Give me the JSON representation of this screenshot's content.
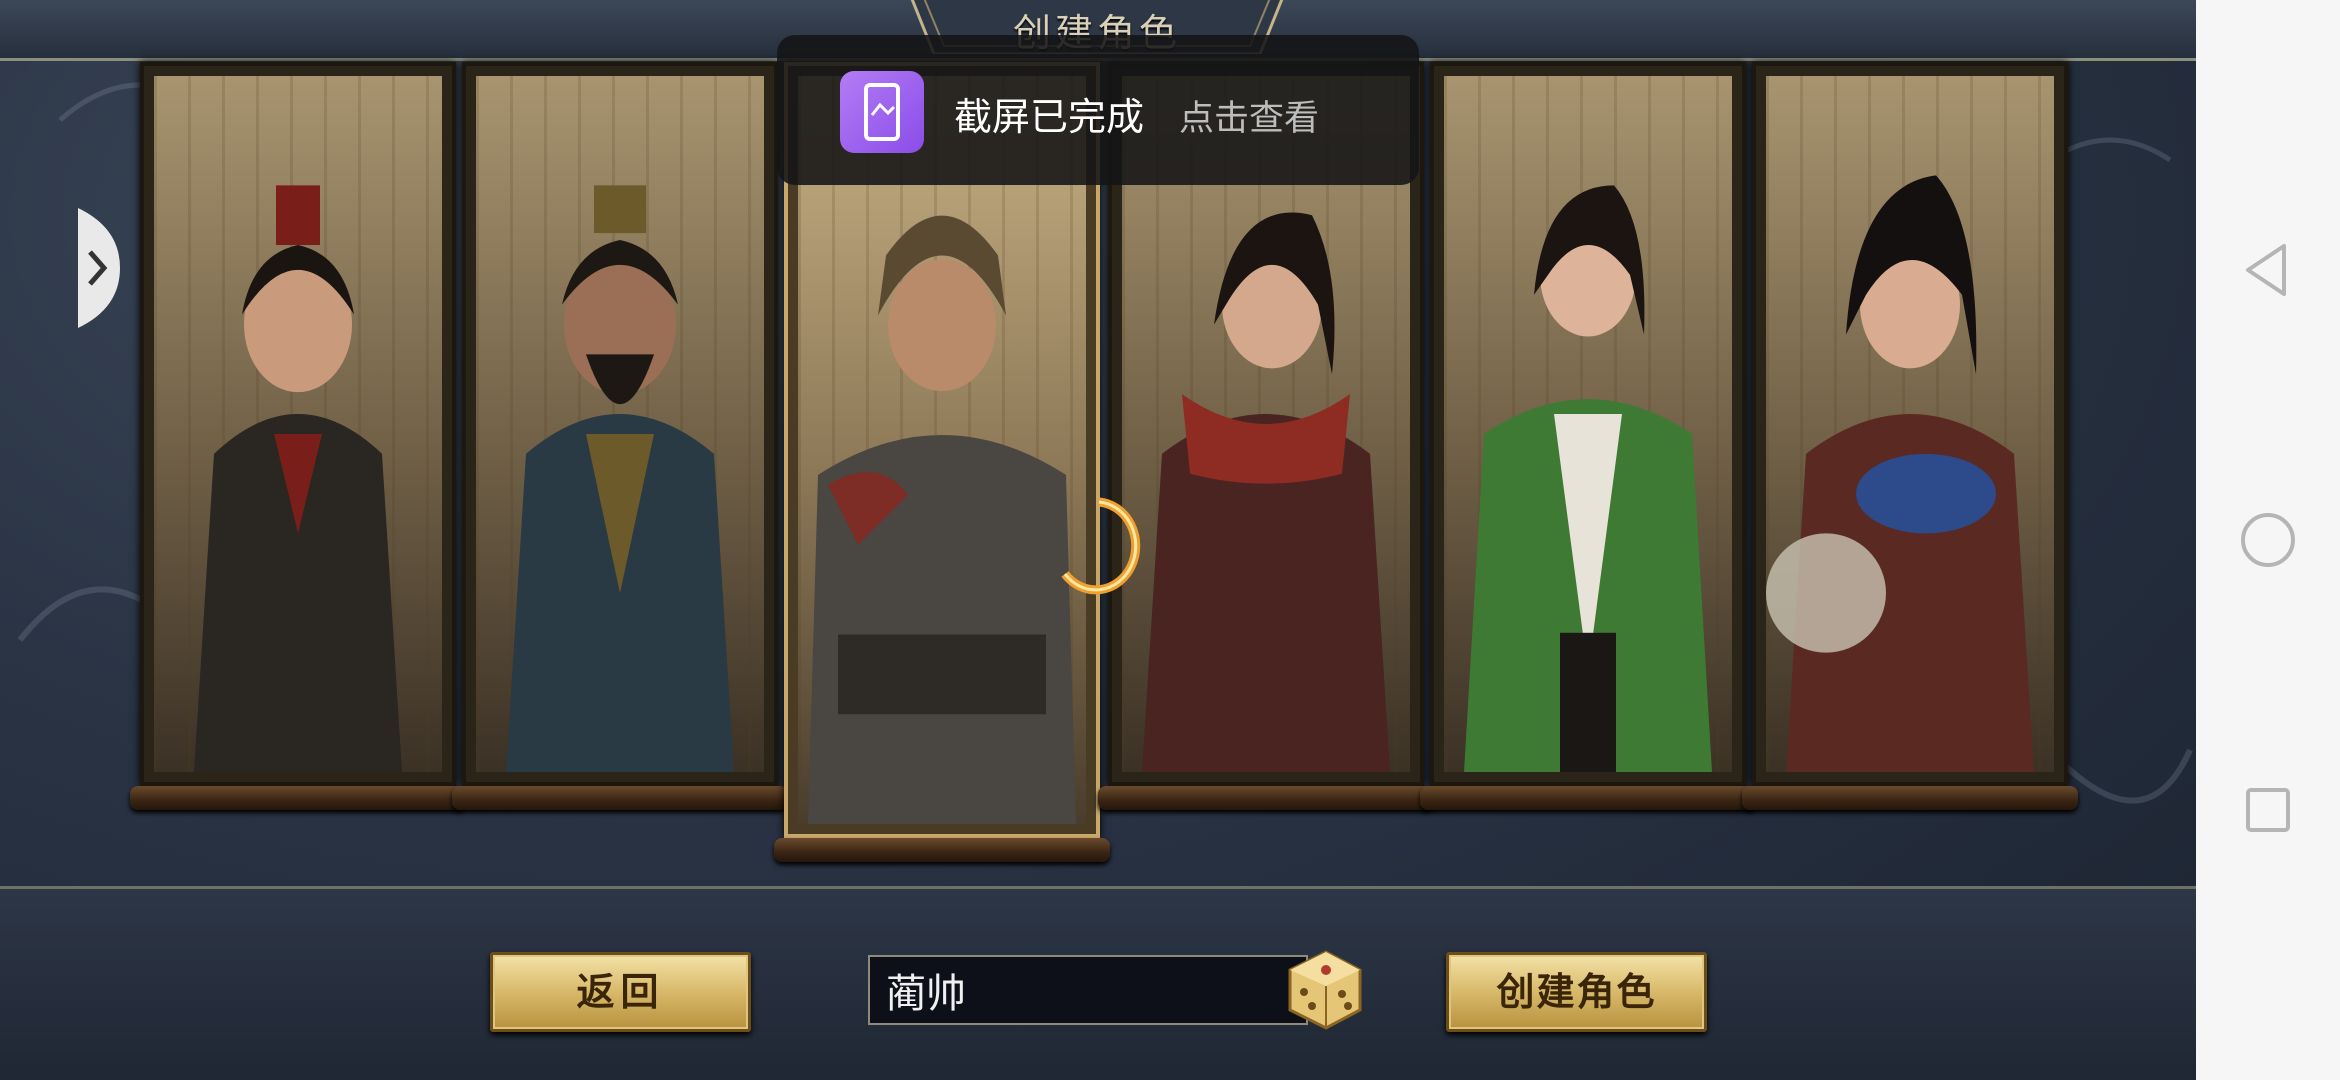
{
  "header": {
    "title": "创建角色"
  },
  "characters": [
    {
      "id": "char-1",
      "robe": "#2a2622",
      "accent": "#7a1e1a",
      "skin": "#c99b7c",
      "hair": "#1a1511",
      "selected": false
    },
    {
      "id": "char-2",
      "robe": "#2a3a44",
      "accent": "#6d5a2a",
      "skin": "#9b6f55",
      "hair": "#1d1813",
      "selected": false
    },
    {
      "id": "char-3",
      "robe": "#4a4641",
      "accent": "#7e2c26",
      "skin": "#b98b6a",
      "hair": "#5a4a32",
      "selected": true
    },
    {
      "id": "char-4",
      "robe": "#4a2420",
      "accent": "#8e2b22",
      "skin": "#d3a88c",
      "hair": "#1b1410",
      "selected": false
    },
    {
      "id": "char-5",
      "robe": "#3e7a34",
      "accent": "#e8e3d8",
      "skin": "#ddb39a",
      "hair": "#1b1410",
      "selected": false
    },
    {
      "id": "char-6",
      "robe": "#5a2a22",
      "accent": "#2d4a8a",
      "skin": "#d9ab90",
      "hair": "#151010",
      "selected": false
    }
  ],
  "toast": {
    "message": "截屏已完成",
    "action": "点击查看"
  },
  "footer": {
    "back_label": "返回",
    "name_value": "蔺帅",
    "create_label": "创建角色"
  },
  "colors": {
    "gold": "#d8b96a",
    "accent_purple": "#9b5cf0",
    "background": "#2a3445"
  },
  "icons": {
    "prev": "chevron-right-icon",
    "dice": "dice-icon",
    "toast": "screenshot-icon",
    "loading": "spinner-icon"
  }
}
